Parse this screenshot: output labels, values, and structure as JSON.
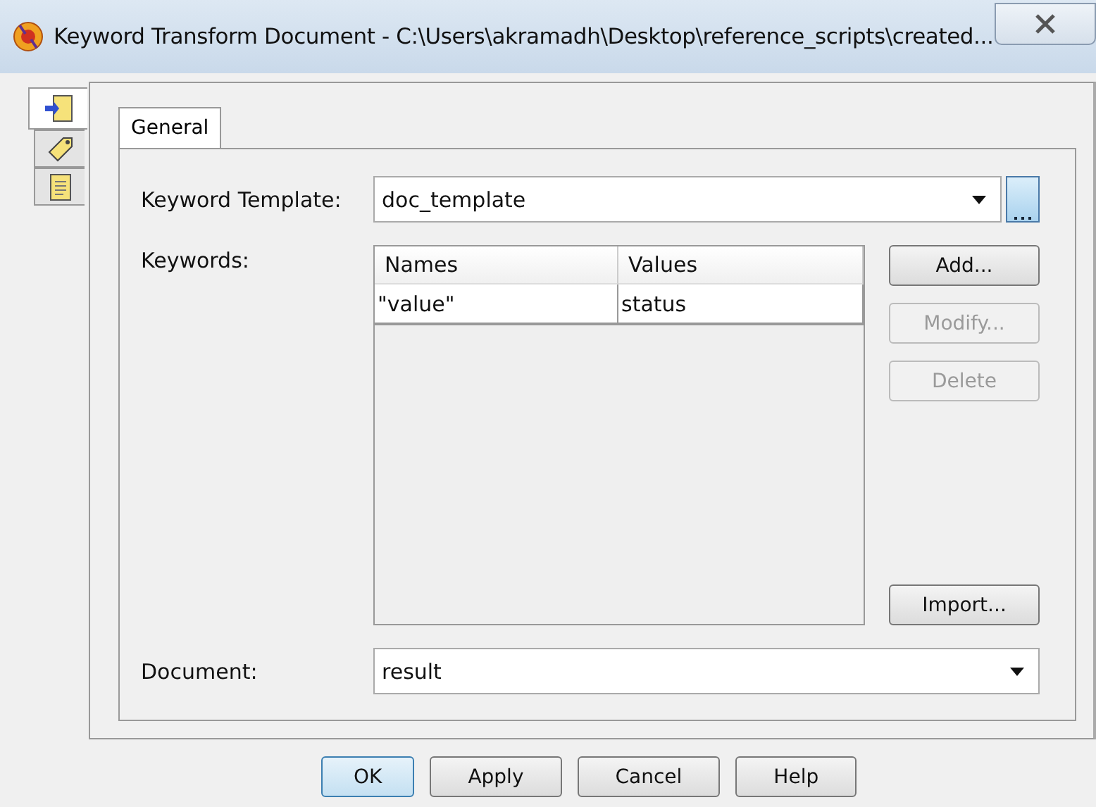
{
  "window": {
    "title": "Keyword Transform Document - C:\\Users\\akramadh\\Desktop\\reference_scripts\\created..."
  },
  "side_tabs": [
    {
      "kind": "transform",
      "selected": true
    },
    {
      "kind": "tag",
      "selected": false
    },
    {
      "kind": "note",
      "selected": false
    }
  ],
  "tabs": [
    {
      "label": "General",
      "selected": true
    }
  ],
  "keyword_template": {
    "label": "Keyword Template:",
    "value": "doc_template"
  },
  "keywords": {
    "label": "Keywords:",
    "columns": [
      "Names",
      "Values"
    ],
    "rows": [
      [
        "\"value\"",
        "status"
      ]
    ]
  },
  "side_buttons": [
    {
      "label": "Add...",
      "disabled": false
    },
    {
      "label": "Modify...",
      "disabled": true
    },
    {
      "label": "Delete",
      "disabled": true
    },
    {
      "label": "Import...",
      "disabled": false
    }
  ],
  "document": {
    "label": "Document:",
    "value": "result"
  },
  "buttons": [
    {
      "label": "OK",
      "default": true
    },
    {
      "label": "Apply",
      "default": false
    },
    {
      "label": "Cancel",
      "default": false
    },
    {
      "label": "Help",
      "default": false
    }
  ]
}
